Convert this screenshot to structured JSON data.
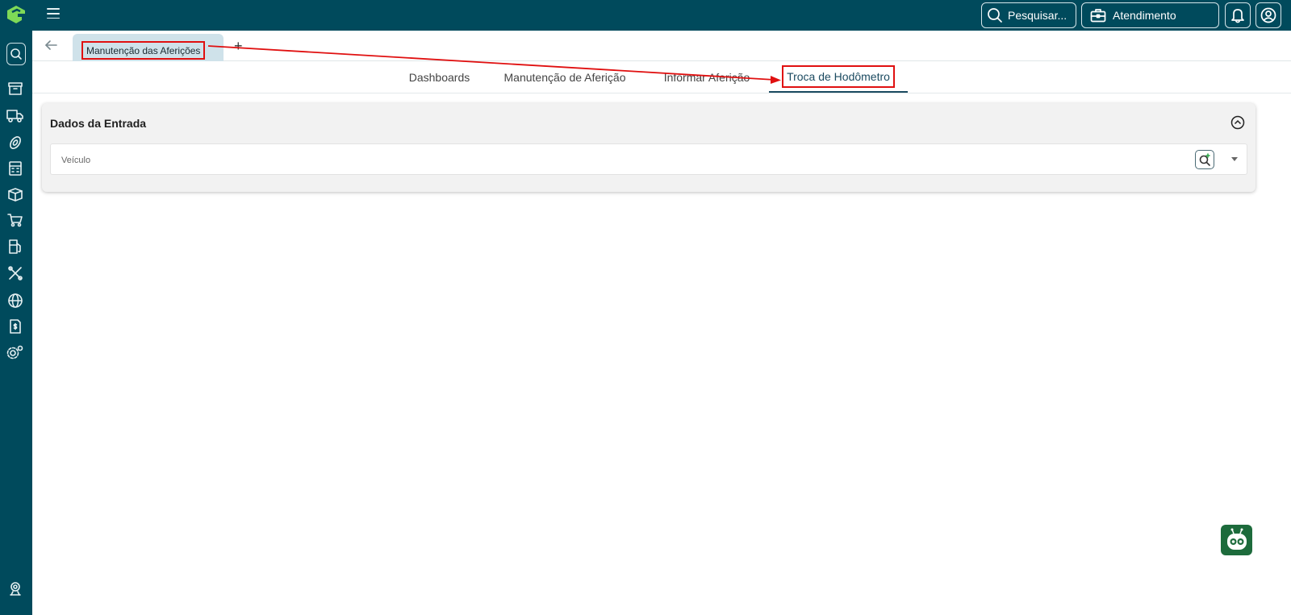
{
  "topbar": {
    "search_label": "Pesquisar...",
    "atendimento_label": "Atendimento"
  },
  "tabs": {
    "active_document": "Manutenção das Aferições",
    "add_symbol": "+"
  },
  "subtabs": [
    {
      "label": "Dashboards"
    },
    {
      "label": "Manutenção de Aferição"
    },
    {
      "label": "Informar Aferição"
    },
    {
      "label": "Troca de Hodômetro",
      "active": true
    }
  ],
  "card": {
    "title": "Dados da Entrada",
    "vehicle_field_label": "Veículo"
  },
  "sidebar": {
    "icons": [
      "search-icon",
      "archive-icon",
      "truck-icon",
      "tire-icon",
      "calculator-icon",
      "box-icon",
      "cart-icon",
      "fuel-icon",
      "tools-icon",
      "globe-icon",
      "invoice-icon",
      "settings-icon",
      "support-icon"
    ]
  },
  "colors": {
    "header_bg": "#004a5c",
    "tab_bg": "#cfe2ea",
    "annotation": "#e01010",
    "bot_bg": "#1d6b3c",
    "logo": "#7ed957"
  }
}
